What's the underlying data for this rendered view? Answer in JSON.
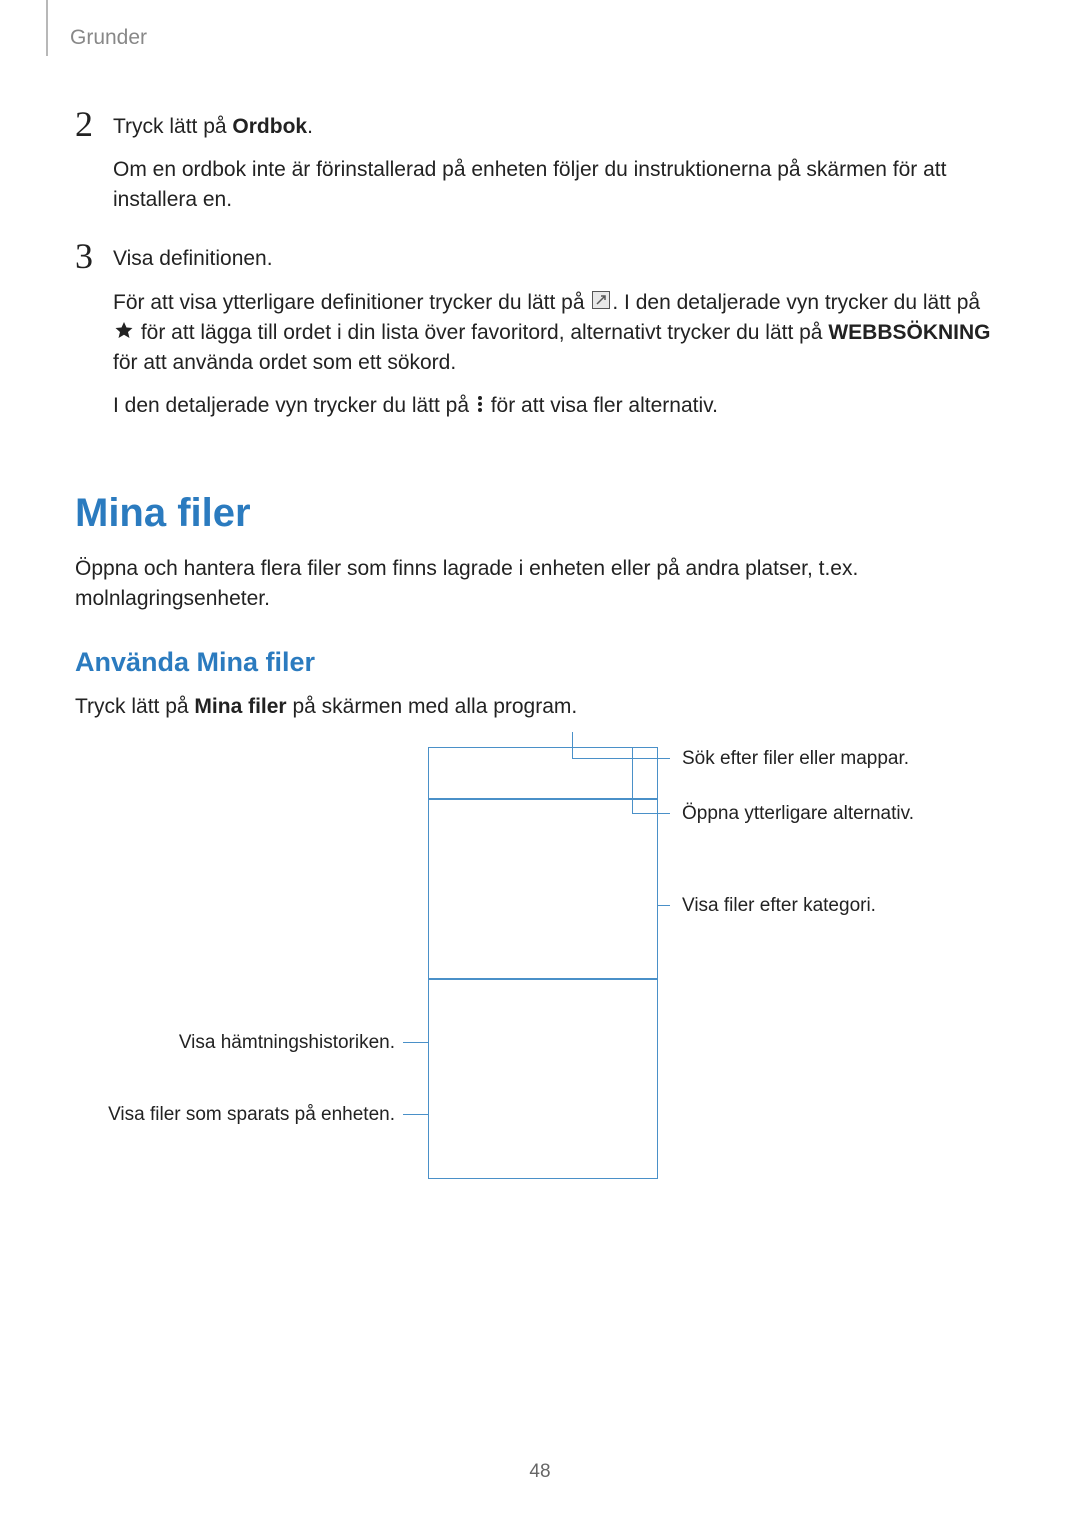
{
  "header": "Grunder",
  "step2": {
    "num": "2",
    "line1_pre": "Tryck lätt på ",
    "line1_bold": "Ordbok",
    "line1_post": ".",
    "line2": "Om en ordbok inte är förinstallerad på enheten följer du instruktionerna på skärmen för att installera en."
  },
  "step3": {
    "num": "3",
    "line1": "Visa definitionen.",
    "para_a1": "För att visa ytterligare definitioner trycker du lätt på ",
    "para_a2": ". I den detaljerade vyn trycker du lätt på ",
    "para_a3": " för att lägga till ordet i din lista över favoritord, alternativt trycker du lätt på ",
    "para_a_bold": "WEBBSÖKNING",
    "para_a4": " för att använda ordet som ett sökord.",
    "para_b1": "I den detaljerade vyn trycker du lätt på ",
    "para_b2": " för att visa fler alternativ."
  },
  "h1": "Mina filer",
  "intro": "Öppna och hantera flera filer som finns lagrade i enheten eller på andra platser, t.ex. molnlagringsenheter.",
  "h2": "Använda Mina filer",
  "subtext_pre": "Tryck lätt på ",
  "subtext_bold": "Mina filer",
  "subtext_post": " på skärmen med alla program.",
  "callouts": {
    "c1": "Sök efter filer eller mappar.",
    "c2": "Öppna ytterligare alternativ.",
    "c3": "Visa filer efter kategori.",
    "c4": "Visa hämtningshistoriken.",
    "c5": "Visa filer som sparats på enheten."
  },
  "page_num": "48"
}
